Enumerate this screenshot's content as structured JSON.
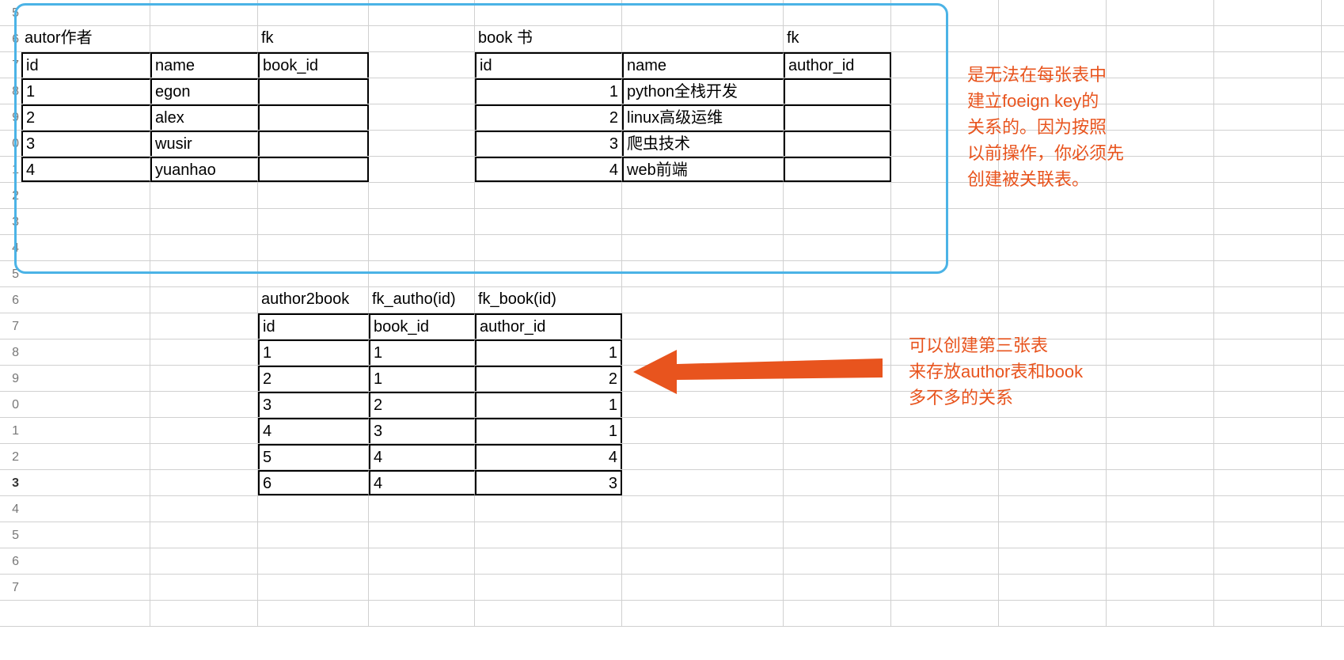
{
  "row_numbers": [
    "5",
    "6",
    "7",
    "8",
    "9",
    "0",
    "1",
    "2",
    "3",
    "4",
    "5",
    "6",
    "7",
    "8",
    "9",
    "0",
    "1",
    "2",
    "3",
    "4",
    "5",
    "6",
    "7"
  ],
  "selected_row_index": 18,
  "author_table": {
    "title": "autor作者",
    "fk_label": "fk",
    "headers": {
      "id": "id",
      "name": "name",
      "book_id": "book_id"
    },
    "rows": [
      {
        "id": "1",
        "name": "egon"
      },
      {
        "id": "2",
        "name": "alex"
      },
      {
        "id": "3",
        "name": "wusir"
      },
      {
        "id": "4",
        "name": "yuanhao"
      }
    ]
  },
  "book_table": {
    "title": "book 书",
    "fk_label": "fk",
    "headers": {
      "id": "id",
      "name": "name",
      "author_id": "author_id"
    },
    "rows": [
      {
        "id": "1",
        "name": "python全栈开发"
      },
      {
        "id": "2",
        "name": "linux高级运维"
      },
      {
        "id": "3",
        "name": "爬虫技术"
      },
      {
        "id": "4",
        "name": "web前端"
      }
    ]
  },
  "link_table": {
    "title": "author2book",
    "fk1_label": "fk_autho(id)",
    "fk2_label": "fk_book(id)",
    "headers": {
      "id": "id",
      "book_id": "book_id",
      "author_id": "author_id"
    },
    "rows": [
      {
        "id": "1",
        "book_id": "1",
        "author_id": "1"
      },
      {
        "id": "2",
        "book_id": "1",
        "author_id": "2"
      },
      {
        "id": "3",
        "book_id": "2",
        "author_id": "1"
      },
      {
        "id": "4",
        "book_id": "3",
        "author_id": "1"
      },
      {
        "id": "5",
        "book_id": "4",
        "author_id": "4"
      },
      {
        "id": "6",
        "book_id": "4",
        "author_id": "3"
      }
    ]
  },
  "annotation1": {
    "line1": "是无法在每张表中",
    "line2": "建立foeign key的",
    "line3": "关系的。因为按照",
    "line4": "以前操作，你必须先",
    "line5": "创建被关联表。"
  },
  "annotation2": {
    "line1": "可以创建第三张表",
    "line2": "来存放author表和book",
    "line3": "多不多的关系"
  }
}
